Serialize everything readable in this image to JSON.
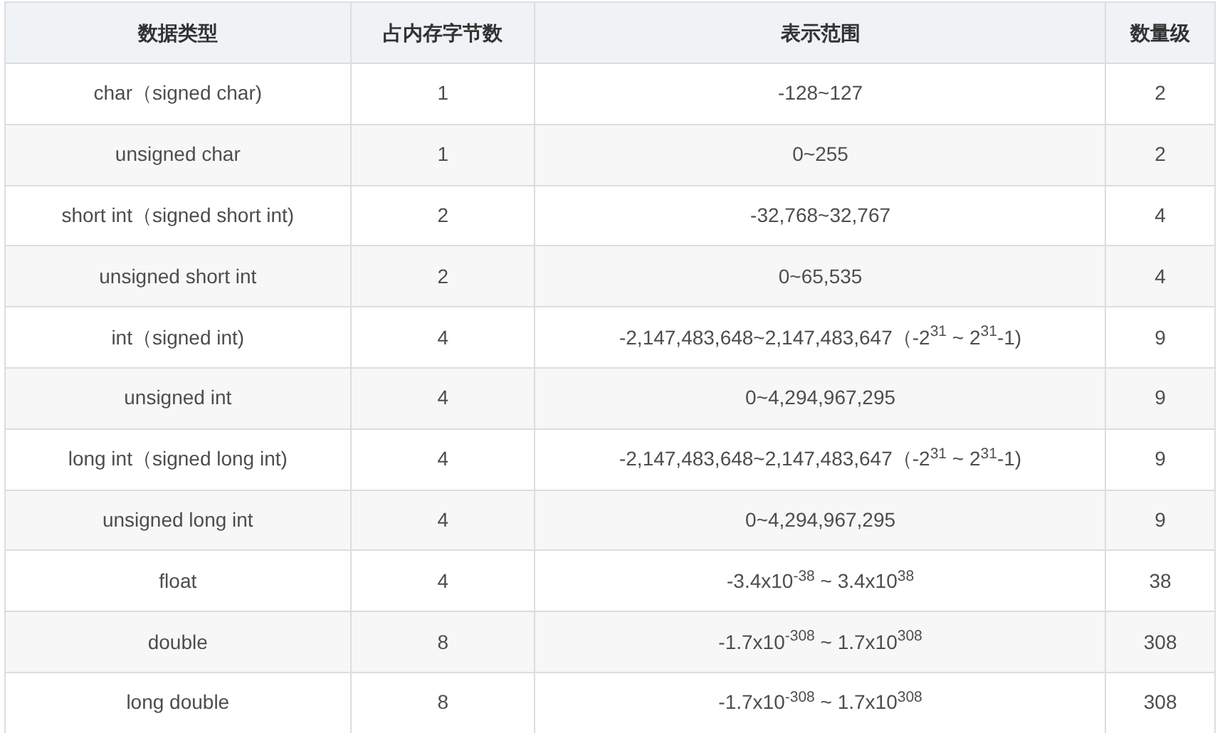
{
  "table": {
    "columns": [
      "数据类型",
      "占内存字节数",
      "表示范围",
      "数量级"
    ],
    "rows": [
      [
        "char（signed char)",
        "1",
        "-128~127",
        "2"
      ],
      [
        "unsigned char",
        "1",
        "0~255",
        "2"
      ],
      [
        "short int（signed short int)",
        "2",
        "-32,768~32,767",
        "4"
      ],
      [
        "unsigned short int",
        "2",
        "0~65,535",
        "4"
      ],
      [
        "int（signed int)",
        "4",
        "-2,147,483,648~2,147,483,647（-2$^{31}$ ~ 2$^{31}$-1)",
        "9"
      ],
      [
        "unsigned int",
        "4",
        "0~4,294,967,295",
        "9"
      ],
      [
        "long int（signed long int)",
        "4",
        "-2,147,483,648~2,147,483,647（-2$^{31}$ ~ 2$^{31}$-1)",
        "9"
      ],
      [
        "unsigned long int",
        "4",
        "0~4,294,967,295",
        "9"
      ],
      [
        "float",
        "4",
        "-3.4x10$^{-38}$ ~ 3.4x10$^{38}$",
        "38"
      ],
      [
        "double",
        "8",
        "-1.7x10$^{-308}$ ~ 1.7x10$^{308}$",
        "308"
      ],
      [
        "long double",
        "8",
        "-1.7x10$^{-308}$ ~ 1.7x10$^{308}$",
        "308"
      ]
    ]
  }
}
